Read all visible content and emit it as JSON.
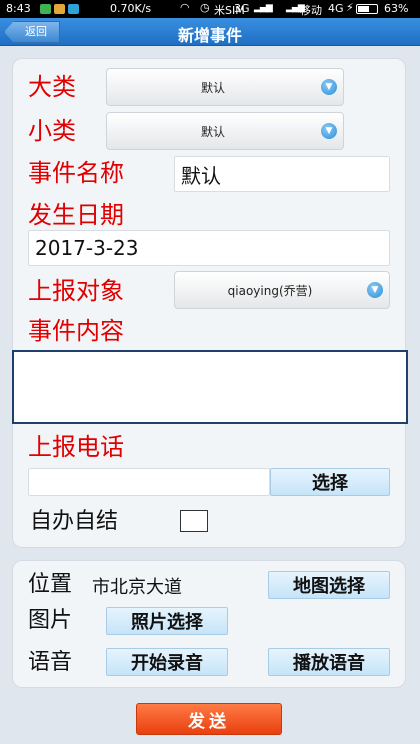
{
  "status_bar": {
    "time": "8:43",
    "net_speed": "0.70K/s",
    "sim1": "米SIM",
    "sim1_net": "3G",
    "sim2": "移动",
    "sim2_net": "4G",
    "battery_percent": "63%",
    "battery_level": 0.63
  },
  "header": {
    "back_label": "返回",
    "title": "新增事件"
  },
  "form": {
    "category_label": "大类",
    "category_value": "默认",
    "subcategory_label": "小类",
    "subcategory_value": "默认",
    "event_name_label": "事件名称",
    "event_name_value": "默认",
    "date_label": "发生日期",
    "date_value": "2017-3-23",
    "report_target_label": "上报对象",
    "report_target_value": "qiaoying(乔营)",
    "content_label": "事件内容",
    "content_value": "",
    "phone_label": "上报电话",
    "phone_value": "",
    "phone_select_button": "选择",
    "self_handle_label": "自办自结",
    "self_handle_checked": false
  },
  "media": {
    "location_label": "位置",
    "location_value": "市北京大道",
    "map_select_button": "地图选择",
    "picture_label": "图片",
    "photo_select_button": "照片选择",
    "voice_label": "语音",
    "start_record_button": "开始录音",
    "play_voice_button": "播放语音"
  },
  "send_button": "发送"
}
